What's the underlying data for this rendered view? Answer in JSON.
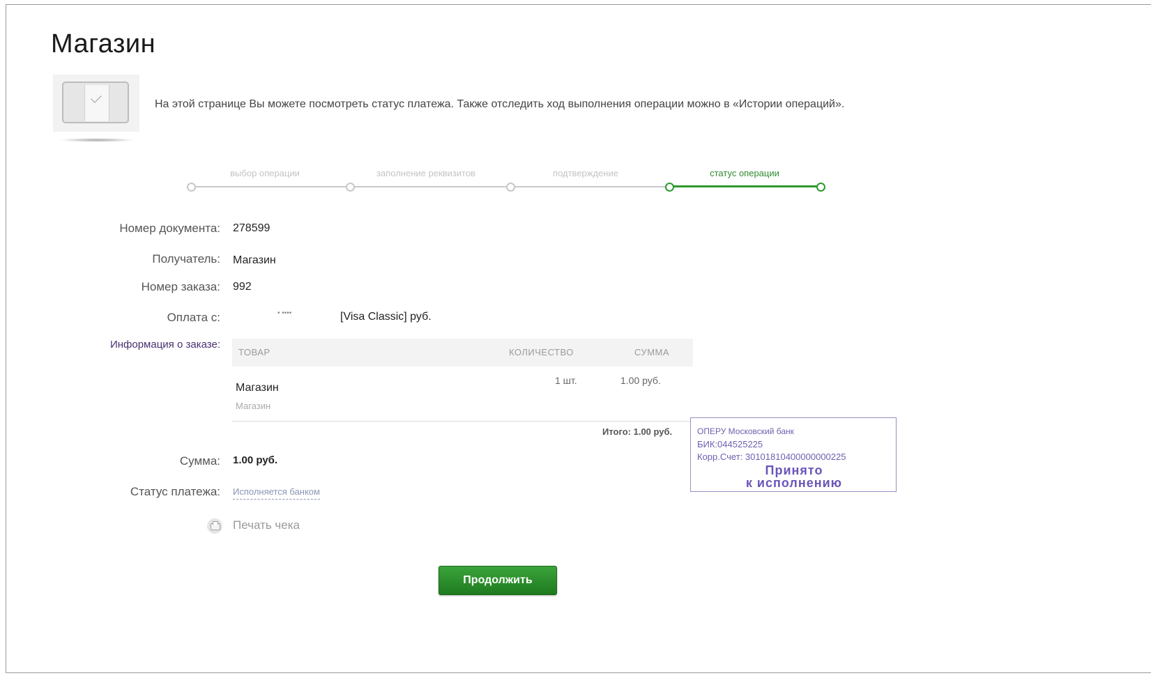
{
  "page": {
    "title": "Магазин",
    "intro": "На этой странице Вы можете посмотреть статус платежа. Также отследить ход выполнения операции можно в «Истории операций»."
  },
  "steps": [
    {
      "label": "выбор операции",
      "state": "done"
    },
    {
      "label": "заполнение реквизитов",
      "state": "done"
    },
    {
      "label": "подтверждение",
      "state": "done"
    },
    {
      "label": "статус операции",
      "state": "active"
    }
  ],
  "details": {
    "doc_number_label": "Номер документа:",
    "doc_number": "278599",
    "recipient_label": "Получатель:",
    "recipient": "Магазин",
    "order_number_label": "Номер заказа:",
    "order_number": "992",
    "payment_from_label": "Оплата с:",
    "card_masked": "• ••••",
    "card_type": "[Visa Classic]  руб.",
    "order_info_label": "Информация о заказе:",
    "sum_label": "Сумма:",
    "sum": "1.00  руб.",
    "status_label": "Статус платежа:",
    "status": "Исполняется банком",
    "print_label": "Печать чека"
  },
  "order_table": {
    "columns": [
      "ТОВАР",
      "КОЛИЧЕСТВО",
      "СУММА"
    ],
    "rows": [
      {
        "name": "Магазин",
        "sub": "Магазин",
        "qty": "1 шт.",
        "sum": "1.00  руб."
      }
    ],
    "total": "Итого: 1.00 руб."
  },
  "stamp": {
    "bank": "ОПЕРУ Московский банк",
    "bik": "БИК:044525225",
    "corr_account": "Корр.Счет: 30101810400000000225",
    "accepted_line1": "Принято",
    "accepted_line2": "к исполнению"
  },
  "actions": {
    "continue": "Продолжить"
  },
  "colors": {
    "accent_green": "#2e9a2e",
    "stamp_purple": "#6e5fb0",
    "link_gray_blue": "#8a96b5"
  }
}
